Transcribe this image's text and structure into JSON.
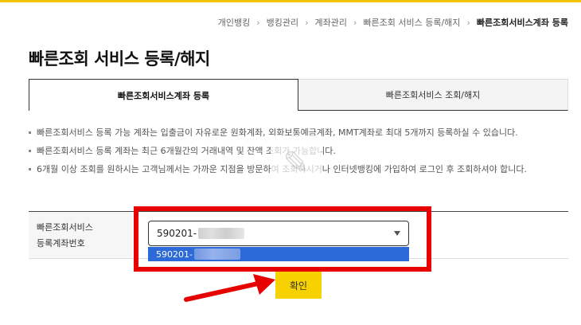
{
  "breadcrumb": {
    "items": [
      "개인뱅킹",
      "뱅킹관리",
      "계좌관리",
      "빠른조회 서비스 등록/해지"
    ],
    "current": "빠른조회서비스계좌 등록"
  },
  "page": {
    "title": "빠른조회 서비스 등록/해지"
  },
  "tabs": [
    {
      "label": "빠른조회서비스계좌 등록",
      "active": true
    },
    {
      "label": "빠른조회서비스 조회/해지",
      "active": false
    }
  ],
  "notes": [
    "빠른조회서비스 등록 가능 계좌는 입출금이 자유로운 원화계좌, 외화보통예금계좌, MMT계좌로 최대 5개까지 등록하실 수 있습니다.",
    "빠른조회서비스 등록 계좌는 최근 6개월간의 거래내역 및 잔액 조회가 가능합니다.",
    "6개월 이상 조회를 원하시는 고객님께서는 가까운 지점을 방문하여 조회하시거나 인터넷뱅킹에 가입하여 로그인 후 조회하셔야 합니다."
  ],
  "form": {
    "label_line1": "빠른조회서비스",
    "label_line2": "등록계좌번호",
    "account_select": {
      "selected_value": "590201-",
      "dropdown_option": "590201-"
    }
  },
  "confirm_button": {
    "label": "확인"
  },
  "colors": {
    "accent_yellow": "#f7d100",
    "highlight_red": "#e60000",
    "selection_blue": "#2b6ad8",
    "top_bar": "#f2c500"
  }
}
